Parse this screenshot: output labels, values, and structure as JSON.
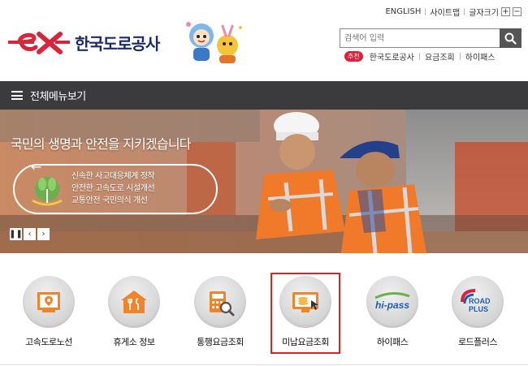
{
  "util": {
    "english": "ENGLISH",
    "sitemap": "사이트맵",
    "fontsize": "글자크기",
    "plus": "+",
    "minus": "−"
  },
  "brand": {
    "name": "한국도로공사",
    "color": "#d9243b"
  },
  "search": {
    "placeholder": "검색어 입력",
    "badge": "추천",
    "recommended": [
      "한국도로공사",
      "요금조회",
      "하이패스"
    ]
  },
  "menubar": {
    "label": "전체메뉴보기"
  },
  "banner": {
    "headline": "국민의 생명과 안전을 지키겠습니다",
    "lines": [
      "신속한 사고대응체계 정착",
      "안전한 고속도로 시설개선",
      "교통안전 국민의식 개선"
    ],
    "controls": {
      "pause": "❚❚",
      "prev": "‹",
      "next": "›"
    }
  },
  "quick": {
    "items": [
      {
        "label": "고속도로노선",
        "icon": "map-pin-icon"
      },
      {
        "label": "휴게소 정보",
        "icon": "restaurant-icon"
      },
      {
        "label": "통행요금조회",
        "icon": "calculator-search-icon"
      },
      {
        "label": "미납요금조회",
        "icon": "monitor-coins-icon",
        "selected": true
      },
      {
        "label": "하이패스",
        "icon": "hipass-logo-icon"
      },
      {
        "label": "로드플러스",
        "icon": "roadplus-logo-icon"
      }
    ]
  },
  "colors": {
    "accent": "#d9243b",
    "menubar": "#3b3b3d",
    "icon_orange": "#f0842a",
    "selected_border": "#e02020"
  }
}
